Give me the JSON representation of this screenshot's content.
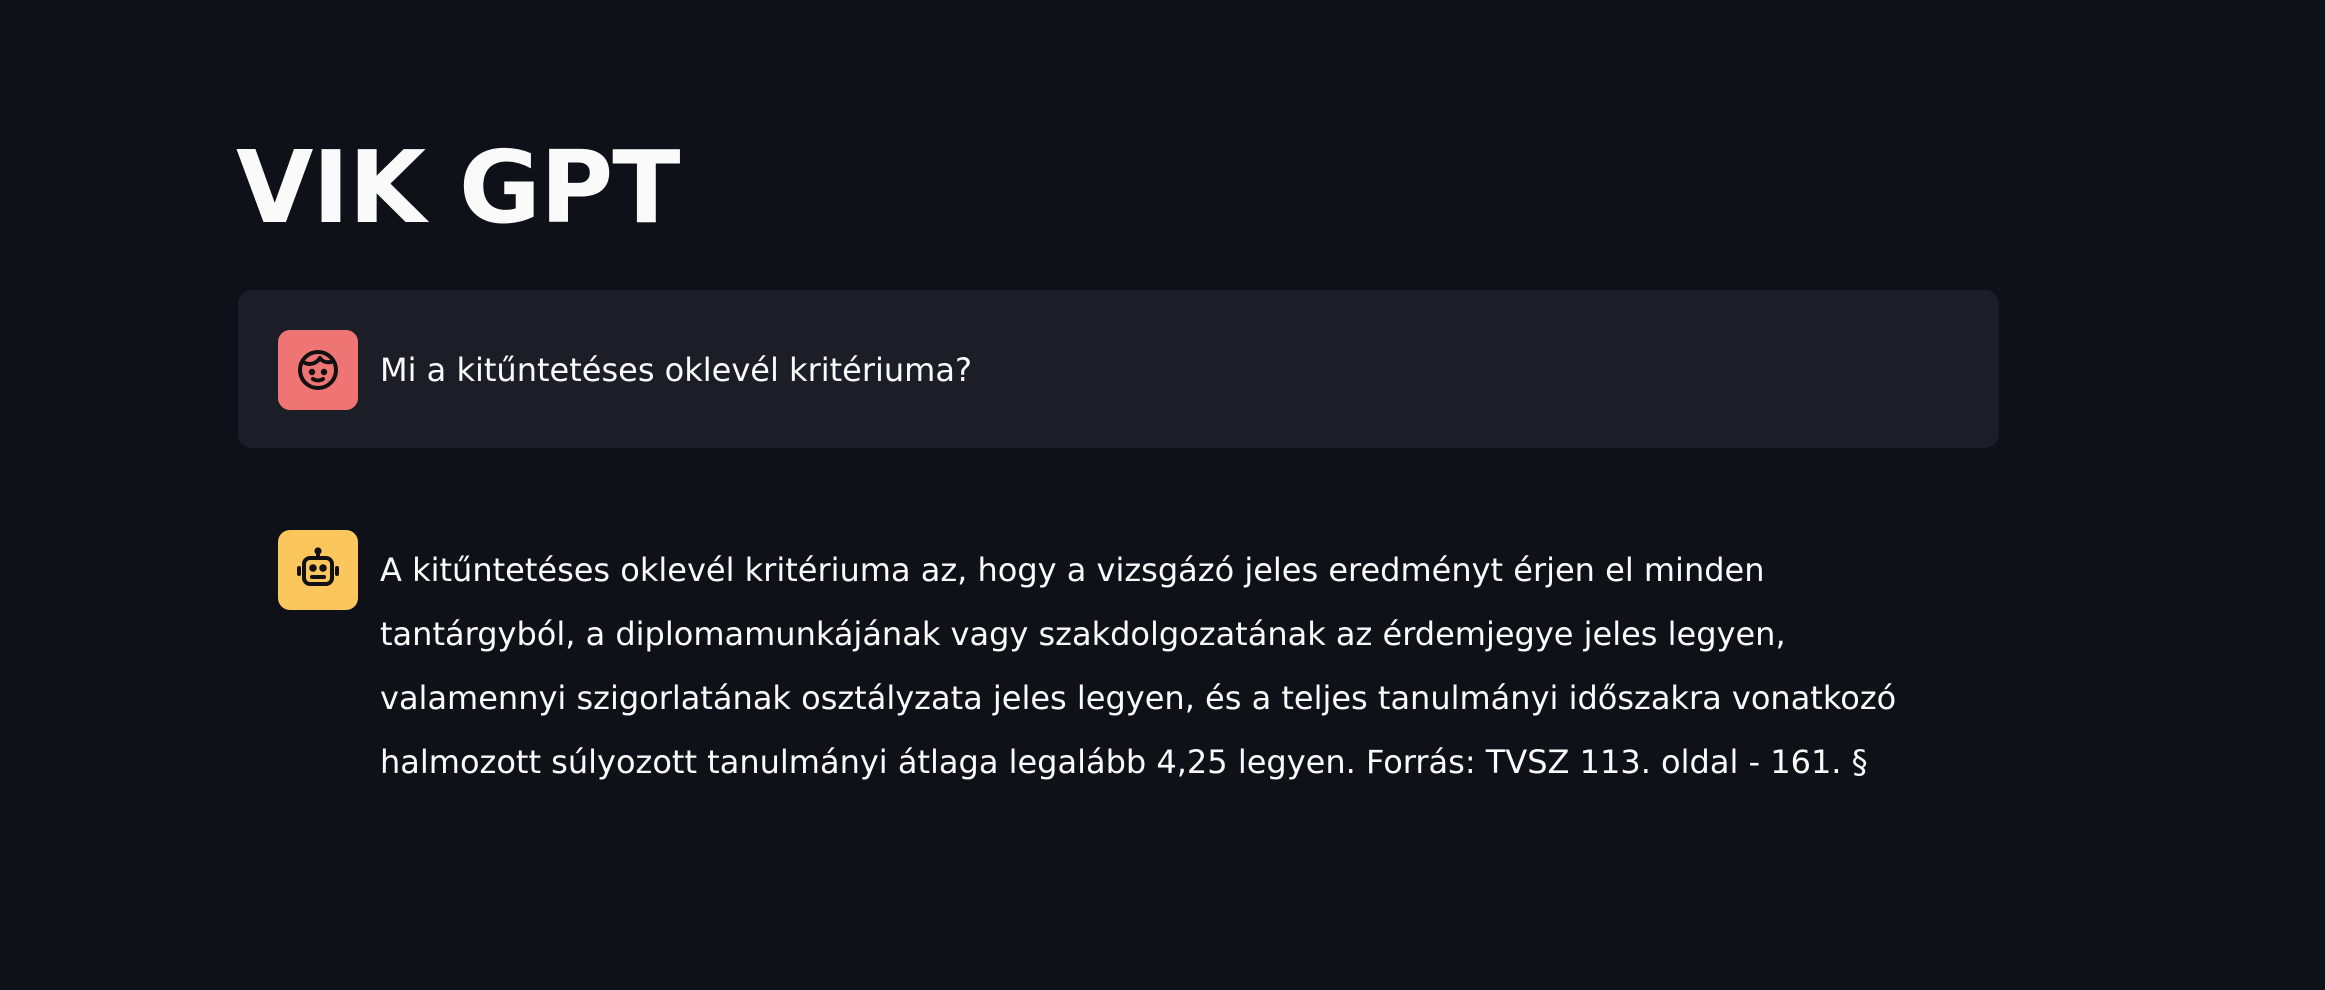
{
  "app": {
    "title": "VIK GPT"
  },
  "chat": {
    "messages": [
      {
        "role": "user",
        "avatar_icon": "user-face-icon",
        "avatar_color": "#ef7474",
        "text": "Mi a kitűntetéses oklevél kritériuma?"
      },
      {
        "role": "assistant",
        "avatar_icon": "robot-icon",
        "avatar_color": "#fbc75d",
        "text": "A kitűntetéses oklevél kritériuma az, hogy a vizsgázó jeles eredményt érjen el minden tantárgyból, a diplomamunkájának vagy szakdolgozatának az érdemjegye jeles legyen, valamennyi szigorlatának osztályzata jeles legyen, és a teljes tanulmányi időszakra vonatkozó halmozott súlyozott tanulmányi átlaga legalább 4,25 legyen. Forrás: TVSZ 113. oldal - 161. §"
      }
    ]
  },
  "colors": {
    "background": "#0e1117",
    "user_bubble": "#1b1e26",
    "text": "#fafafa"
  }
}
